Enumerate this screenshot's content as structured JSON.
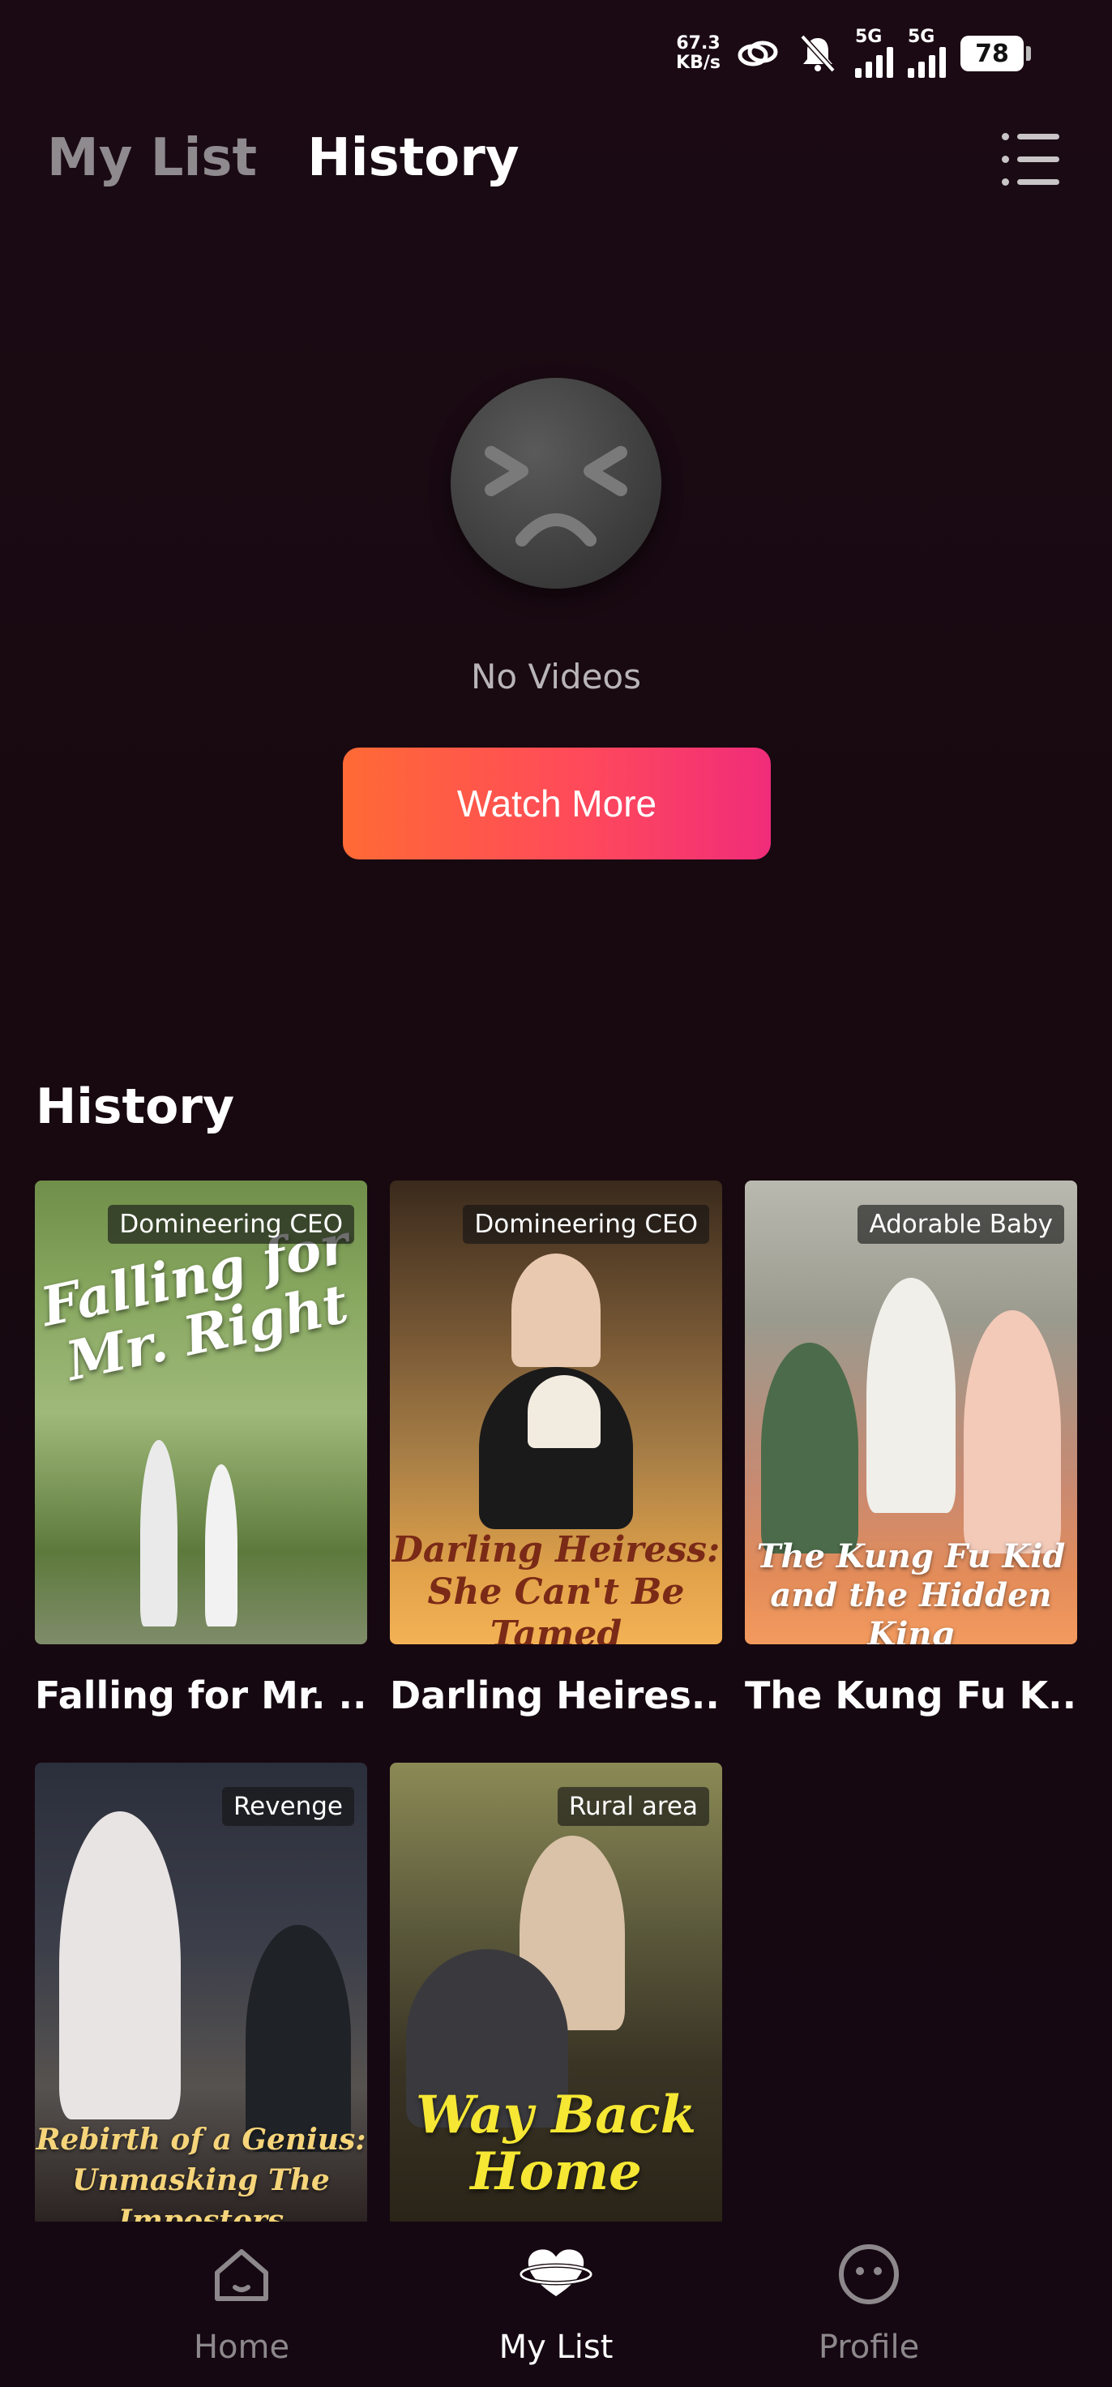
{
  "status_bar": {
    "speed_value": "67.3",
    "speed_unit": "KB/s",
    "network1": "5G",
    "network2": "5G",
    "battery": "78"
  },
  "header": {
    "tabs": [
      {
        "label": "My List",
        "active": false
      },
      {
        "label": "History",
        "active": true
      }
    ],
    "menu_icon": "list-menu-icon"
  },
  "empty_state": {
    "icon": "sad-face-icon",
    "message": "No Videos",
    "button_label": "Watch More"
  },
  "history": {
    "title": "History",
    "items": [
      {
        "title": "Falling for Mr. ...",
        "tag": "Domineering CEO",
        "poster_text": "Falling for Mr. Right"
      },
      {
        "title": "Darling Heires...",
        "tag": "Domineering CEO",
        "poster_text": "Darling Heiress: She Can't Be Tamed"
      },
      {
        "title": "The Kung Fu K...",
        "tag": "Adorable Baby",
        "poster_text": "The Kung Fu Kid and the Hidden King"
      },
      {
        "title": "",
        "tag": "Revenge",
        "poster_text": "Rebirth of a Genius: Unmasking The Impostors"
      },
      {
        "title": "",
        "tag": "Rural area",
        "poster_text": "Way Back Home"
      }
    ]
  },
  "bottom_nav": {
    "items": [
      {
        "label": "Home",
        "icon": "home-icon",
        "active": false
      },
      {
        "label": "My List",
        "icon": "heart-planet-icon",
        "active": true
      },
      {
        "label": "Profile",
        "icon": "smiley-profile-icon",
        "active": false
      }
    ]
  },
  "colors": {
    "background": "#17080f",
    "button_gradient_start": "#ff6a35",
    "button_gradient_end": "#f02c7a"
  }
}
